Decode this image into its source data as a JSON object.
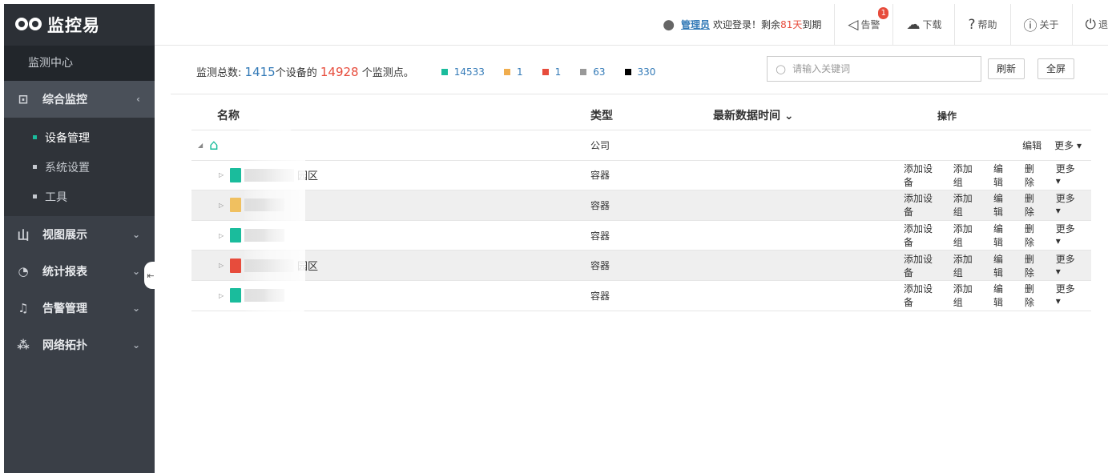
{
  "app": {
    "title": "监控易"
  },
  "sidebar": {
    "section": "监测中心",
    "menus": [
      {
        "label": "综合监控",
        "icon": "dashboard-icon",
        "arrow": "‹"
      },
      {
        "label": "视图展示",
        "icon": "bar-chart-icon",
        "arrow": "⌄"
      },
      {
        "label": "统计报表",
        "icon": "pie-chart-icon",
        "arrow": "⌄"
      },
      {
        "label": "告警管理",
        "icon": "bell-icon",
        "arrow": "⌄"
      },
      {
        "label": "网络拓扑",
        "icon": "topology-icon",
        "arrow": "⌄"
      }
    ],
    "submenu": [
      {
        "label": "设备管理"
      },
      {
        "label": "系统设置"
      },
      {
        "label": "工具"
      }
    ]
  },
  "topbar": {
    "user": "管理员",
    "welcome_prefix": "欢迎登录！剩余",
    "days": "81天",
    "welcome_suffix": "到期",
    "alarm": "告警",
    "alarm_badge": "1",
    "download": "下载",
    "help": "帮助",
    "about": "关于",
    "logout": "退"
  },
  "stats": {
    "prefix": "监测总数:",
    "devices": "1415",
    "devices_label": "个设备的",
    "points": "14928",
    "points_label": "个监测点。",
    "legend": [
      {
        "color": "#1abc9c",
        "value": "14533"
      },
      {
        "color": "#f0ad4e",
        "value": "1"
      },
      {
        "color": "#e74c3c",
        "value": "1"
      },
      {
        "color": "#999999",
        "value": "63"
      },
      {
        "color": "#000000",
        "value": "330"
      }
    ]
  },
  "search": {
    "placeholder": "请输入关键词"
  },
  "buttons": {
    "refresh": "刷新",
    "fullscreen": "全屏"
  },
  "table": {
    "headers": {
      "name": "名称",
      "type": "类型",
      "time": "最新数据时间 ⌄",
      "ops": "操作"
    },
    "root": {
      "type": "公司",
      "edit": "编辑",
      "more": "更多 ▾"
    },
    "rows": [
      {
        "name_suffix": "园区",
        "type": "容器",
        "color": "#1abc9c"
      },
      {
        "name_suffix": "",
        "type": "容器",
        "color": "#f0c060"
      },
      {
        "name_suffix": "",
        "type": "容器",
        "color": "#1abc9c"
      },
      {
        "name_suffix": "园区",
        "type": "容器",
        "color": "#e74c3c"
      },
      {
        "name_suffix": "",
        "type": "容器",
        "color": "#1abc9c"
      }
    ],
    "row_ops": {
      "add_device": "添加设备",
      "add_group": "添加组",
      "edit": "编辑",
      "delete": "删除",
      "more": "更多 ▾"
    }
  }
}
